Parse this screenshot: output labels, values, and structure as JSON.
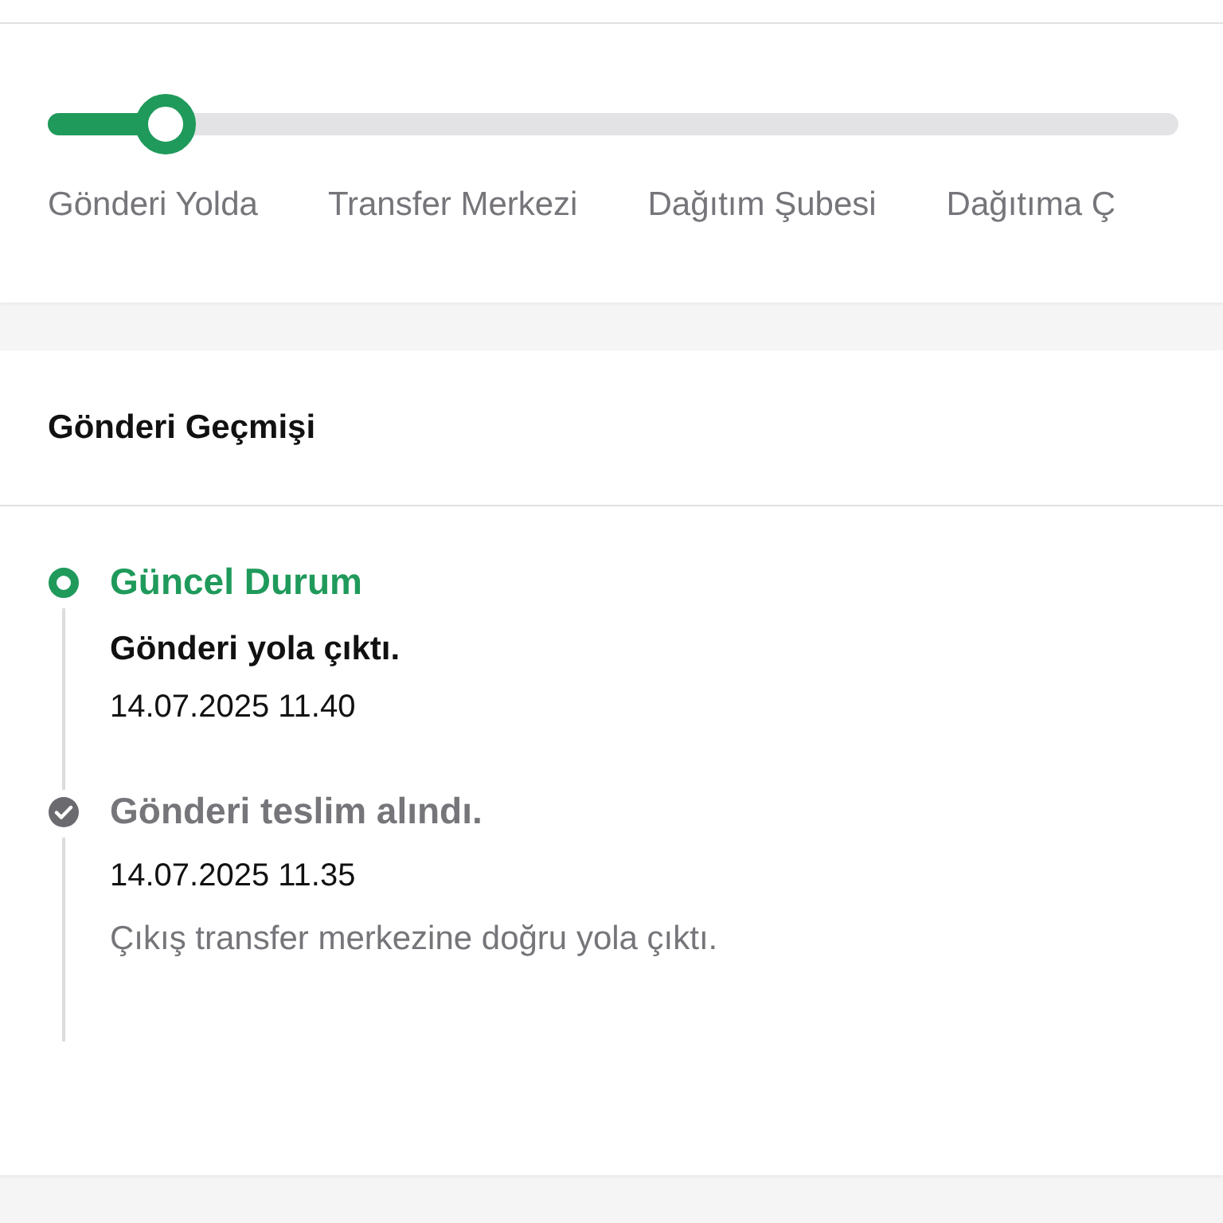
{
  "progress": {
    "level": 0.104,
    "steps": [
      {
        "label": "Gönderi Yolda"
      },
      {
        "label": "Transfer Merkezi"
      },
      {
        "label": "Dağıtım Şubesi"
      },
      {
        "label": "Dağıtıma Ç"
      }
    ]
  },
  "history": {
    "title": "Gönderi Geçmişi",
    "events": [
      {
        "kind": "current",
        "status": "Güncel Durum",
        "description": "Gönderi yola çıktı.",
        "date": "14.07.2025 11.40"
      },
      {
        "kind": "done",
        "status": "Gönderi teslim alındı.",
        "date": "14.07.2025 11.35",
        "note": "Çıkış transfer merkezine doğru yola çıktı."
      }
    ]
  }
}
